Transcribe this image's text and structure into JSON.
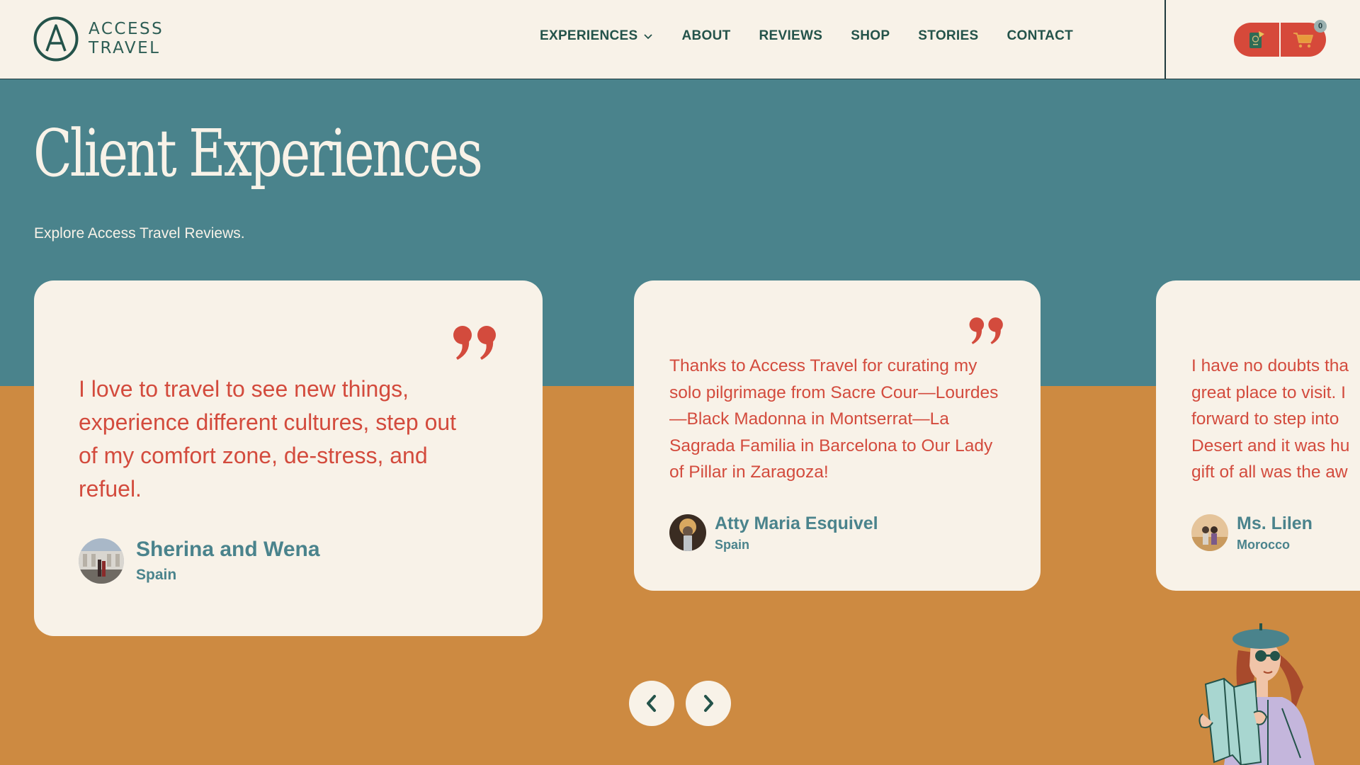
{
  "brand": {
    "line1": "ACCESS",
    "line2": "TRAVEL",
    "icon": "letter-a-circle-logo"
  },
  "nav": {
    "items": [
      {
        "label": "EXPERIENCES",
        "has_dropdown": true
      },
      {
        "label": "ABOUT"
      },
      {
        "label": "REVIEWS"
      },
      {
        "label": "SHOP"
      },
      {
        "label": "STORIES"
      },
      {
        "label": "CONTACT"
      }
    ]
  },
  "header_actions": {
    "passport_icon": "passport-icon",
    "cart_icon": "shopping-cart-icon",
    "cart_count": "0"
  },
  "hero": {
    "title": "Client Experiences",
    "subtitle": "Explore Access Travel Reviews."
  },
  "reviews": [
    {
      "quote": "I love to travel to see new things, experience different cultures, step out of my comfort zone, de-stress, and refuel.",
      "name": "Sherina and Wena",
      "location": "Spain"
    },
    {
      "quote": "Thanks to Access Travel for curating my solo pilgrimage from Sacre Cour—Lourdes—Black Madonna in Montserrat—La Sagrada Familia in Barcelona to Our Lady of Pillar in Zaragoza!",
      "name": "Atty Maria Esquivel",
      "location": "Spain"
    },
    {
      "quote_lines": [
        "I have no doubts tha",
        "great place to visit. I",
        "forward to step into",
        "Desert and it was hu",
        "gift of all was the aw"
      ],
      "name": "Ms. Lilen",
      "location": "Morocco"
    }
  ],
  "carousel": {
    "prev_icon": "chevron-left-icon",
    "next_icon": "chevron-right-icon"
  },
  "colors": {
    "cream": "#f8f2e8",
    "teal": "#4a838c",
    "orange": "#cd8a41",
    "red": "#d34b3d",
    "dark_green": "#24534a"
  }
}
